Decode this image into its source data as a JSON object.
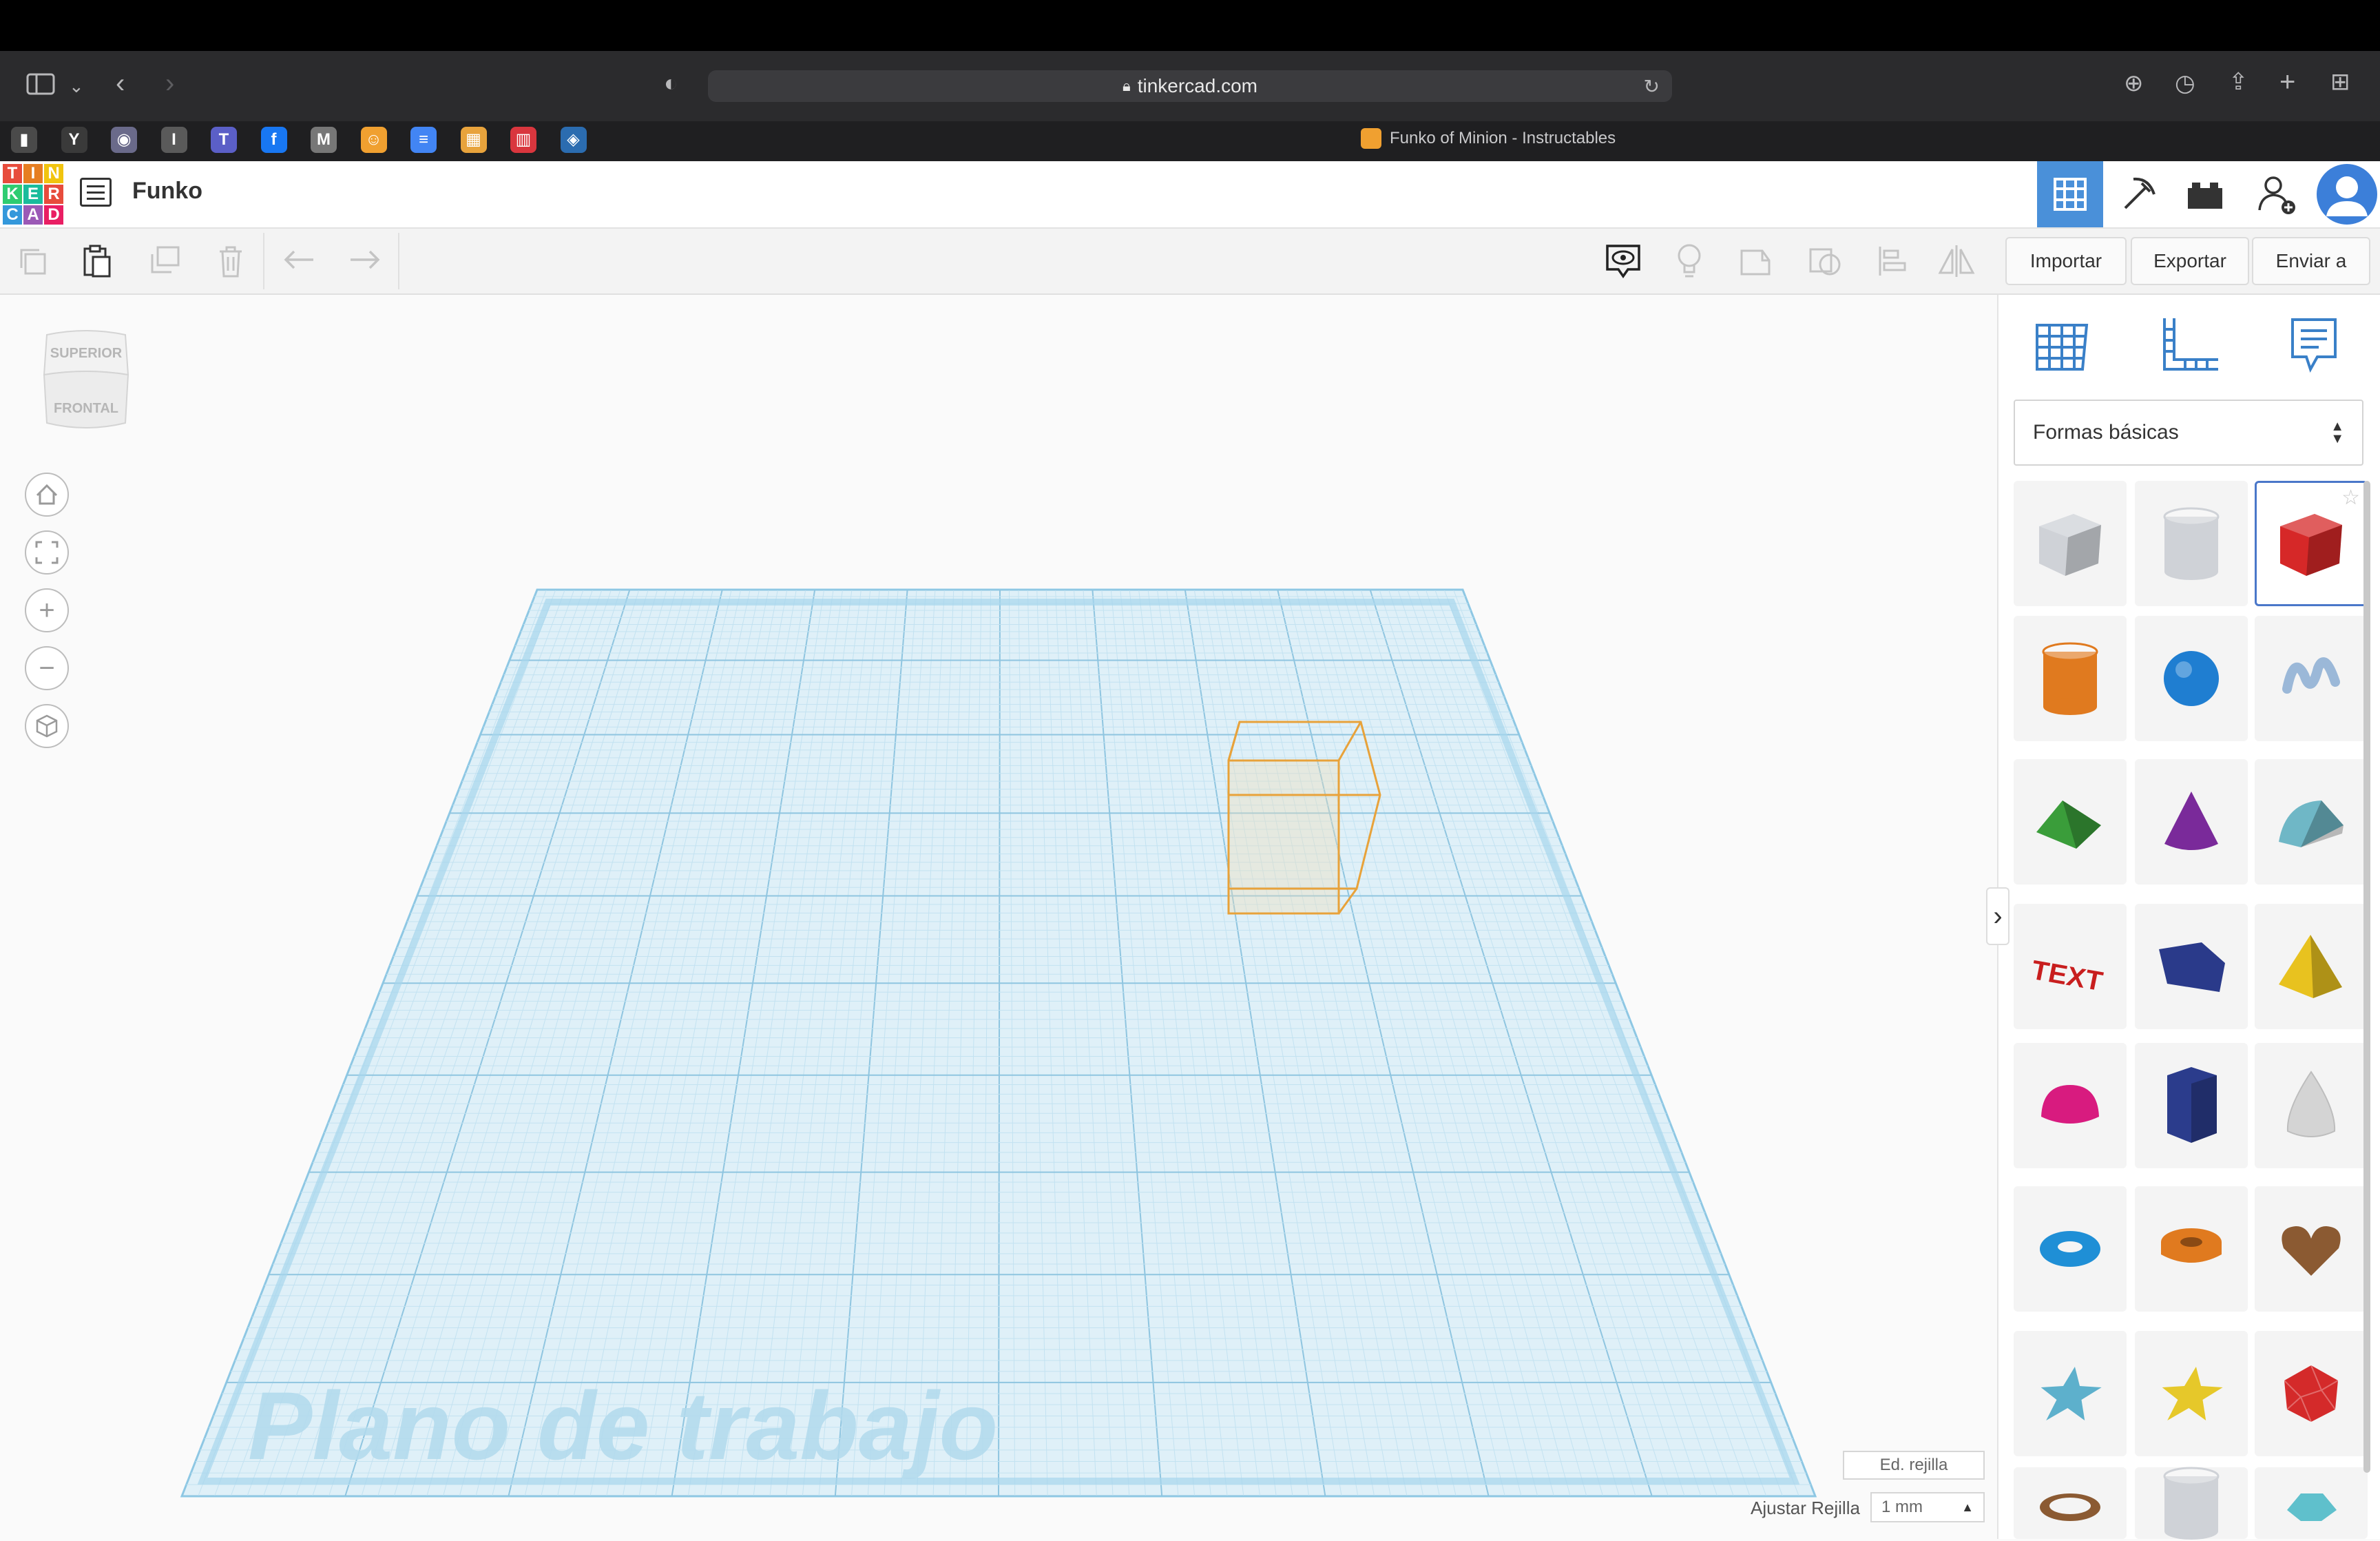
{
  "browser": {
    "url": "tinkercad.com",
    "active_tab_title": "Funko of Minion - Instructables",
    "favorites": [
      {
        "name": "favicon-1",
        "color": "#4a4a4a",
        "glyph": "▮"
      },
      {
        "name": "favicon-2",
        "color": "#3a3a3a",
        "glyph": "Y"
      },
      {
        "name": "favicon-3",
        "color": "#6a6a8a",
        "glyph": "◉"
      },
      {
        "name": "favicon-4",
        "color": "#5a5a5a",
        "glyph": "I"
      },
      {
        "name": "favicon-5",
        "color": "#5b5fc7",
        "glyph": "T"
      },
      {
        "name": "favicon-6",
        "color": "#1877f2",
        "glyph": "f"
      },
      {
        "name": "favicon-7",
        "color": "#777777",
        "glyph": "M"
      },
      {
        "name": "favicon-8",
        "color": "#f0a030",
        "glyph": "☺"
      },
      {
        "name": "favicon-9",
        "color": "#4285f4",
        "glyph": "≡"
      },
      {
        "name": "favicon-10",
        "color": "#e8a33c",
        "glyph": "▦"
      },
      {
        "name": "favicon-11",
        "color": "#d9363e",
        "glyph": "▥"
      },
      {
        "name": "favicon-12",
        "color": "#2b6cb0",
        "glyph": "◈"
      }
    ]
  },
  "logo": {
    "letters": [
      "T",
      "I",
      "N",
      "K",
      "E",
      "R",
      "C",
      "A",
      "D"
    ],
    "colors": [
      "#e74c3c",
      "#e67e22",
      "#f1c40f",
      "#2ecc71",
      "#1abc9c",
      "#e74c3c",
      "#3498db",
      "#9b59b6",
      "#e91e63"
    ]
  },
  "project": {
    "name": "Funko"
  },
  "toolbar": {
    "import_label": "Importar",
    "export_label": "Exportar",
    "send_label": "Enviar a"
  },
  "viewcube": {
    "top_label": "SUPERIOR",
    "front_label": "FRONTAL"
  },
  "workplane": {
    "label": "Plano de trabajo",
    "edit_grid_label": "Ed. rejilla",
    "snap_label": "Ajustar Rejilla",
    "snap_value": "1 mm"
  },
  "shapes_panel": {
    "category": "Formas básicas",
    "shapes": [
      {
        "name": "box-hole",
        "color": "#c9cdd3"
      },
      {
        "name": "cylinder-hole",
        "color": "#c9cdd3"
      },
      {
        "name": "box",
        "color": "#d62828"
      },
      {
        "name": "cylinder",
        "color": "#e07a1f"
      },
      {
        "name": "sphere",
        "color": "#1f7ed1"
      },
      {
        "name": "scribble",
        "color": "#9bb8d8"
      },
      {
        "name": "roof",
        "color": "#3a9d3a"
      },
      {
        "name": "cone",
        "color": "#7a2a9a"
      },
      {
        "name": "round-roof",
        "color": "#6fb7c6"
      },
      {
        "name": "text",
        "color": "#c81e1e"
      },
      {
        "name": "wedge",
        "color": "#2a3a8a"
      },
      {
        "name": "pyramid",
        "color": "#e8c21f"
      },
      {
        "name": "half-sphere",
        "color": "#d81b7f"
      },
      {
        "name": "polygon",
        "color": "#2b3c8c"
      },
      {
        "name": "paraboloid",
        "color": "#d4d4d4"
      },
      {
        "name": "torus",
        "color": "#1f8fd6"
      },
      {
        "name": "tube",
        "color": "#e07a1f"
      },
      {
        "name": "heart",
        "color": "#8b5a32"
      },
      {
        "name": "star",
        "color": "#5db0cc"
      },
      {
        "name": "star-yellow",
        "color": "#e6c82a"
      },
      {
        "name": "icosahedron",
        "color": "#d42a2a"
      },
      {
        "name": "ring",
        "color": "#8b5a32"
      },
      {
        "name": "cylinder-hole-2",
        "color": "#c9cdd3"
      },
      {
        "name": "teal-shape",
        "color": "#5fc0cc"
      }
    ]
  }
}
